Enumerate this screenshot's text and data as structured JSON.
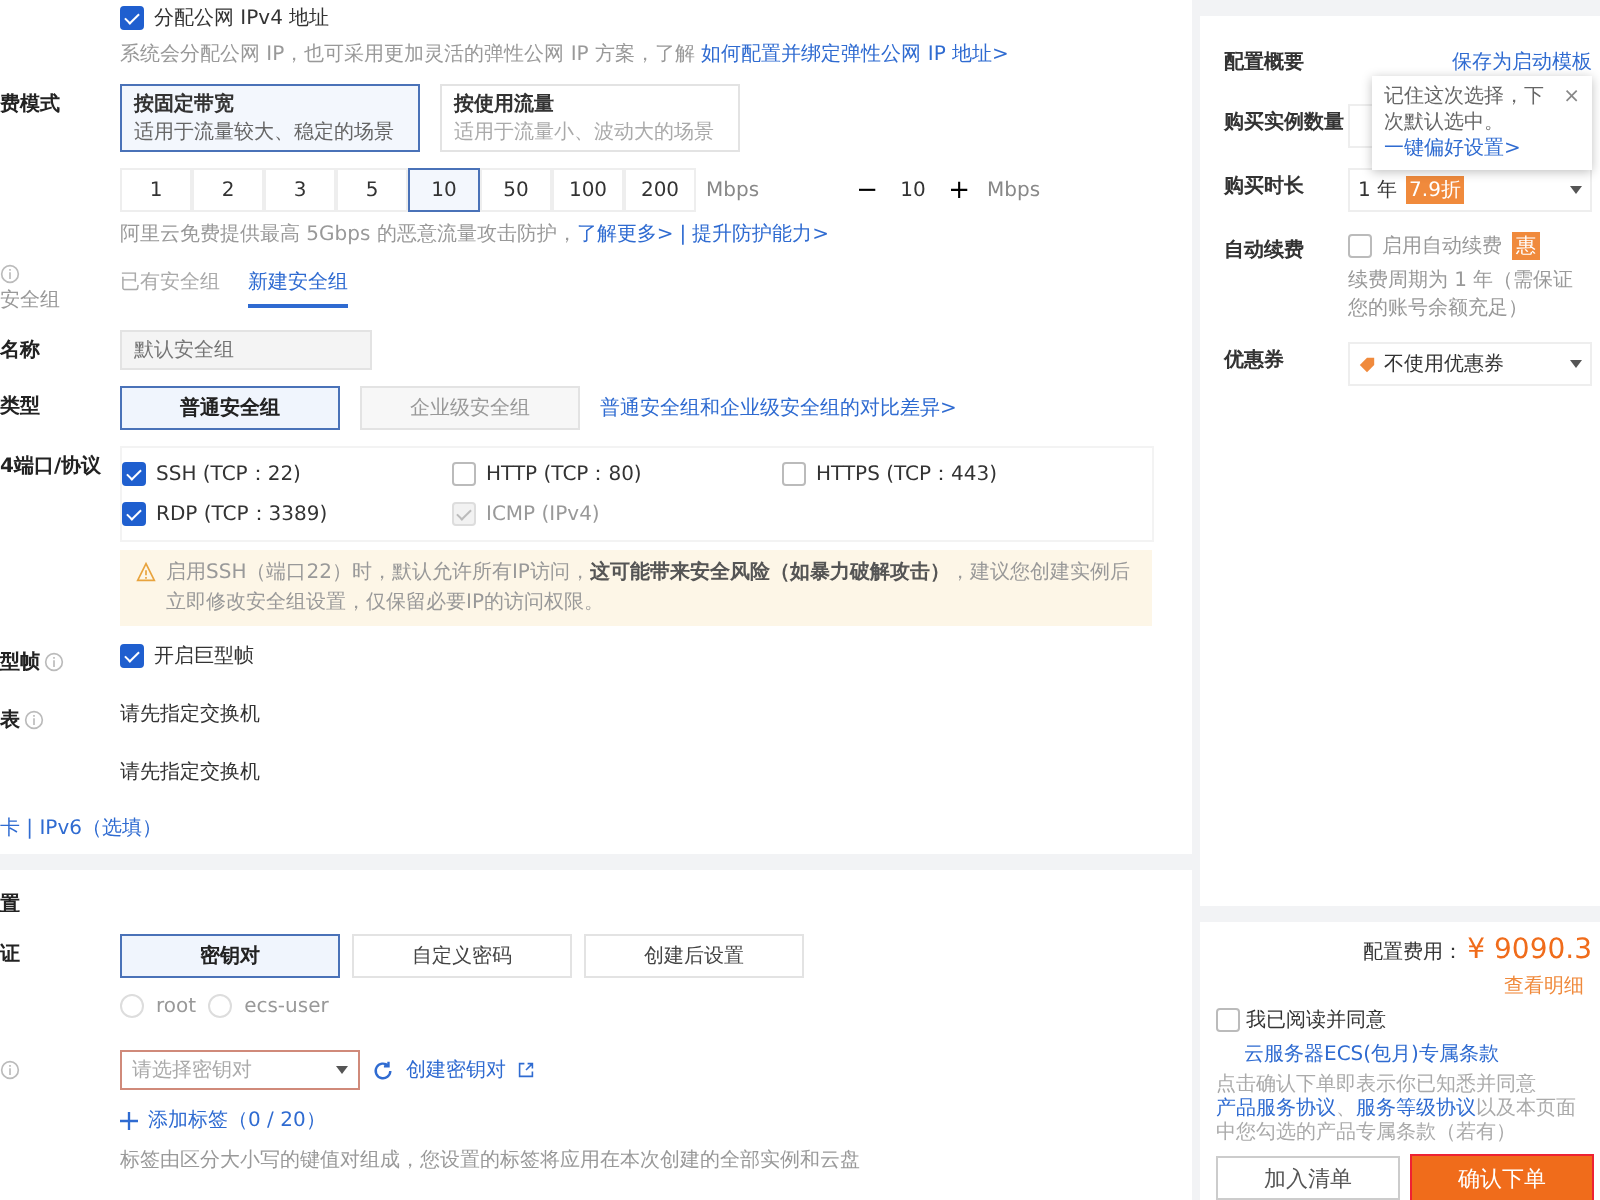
{
  "public_ip": {
    "checked": true,
    "label": "分配公网 IPv4 地址",
    "hint": "系统会分配公网 IP，也可采用更加灵活的弹性公网 IP 方案，了解 ",
    "hint_link": "如何配置并绑定弹性公网 IP 地址>"
  },
  "billing": {
    "label": "费模式",
    "options": [
      {
        "title": "按固定带宽",
        "desc": "适用于流量较大、稳定的场景",
        "selected": true
      },
      {
        "title": "按使用流量",
        "desc": "适用于流量小、波动大的场景",
        "selected": false
      }
    ]
  },
  "bandwidth": {
    "options": [
      {
        "label": "1",
        "selected": false
      },
      {
        "label": "2",
        "selected": false
      },
      {
        "label": "3",
        "selected": false
      },
      {
        "label": "5",
        "selected": false
      },
      {
        "label": "10",
        "selected": true
      },
      {
        "label": "50",
        "selected": false
      },
      {
        "label": "100",
        "selected": false
      },
      {
        "label": "200",
        "selected": false
      }
    ],
    "unit": "Mbps",
    "stepper": {
      "minus": "−",
      "value": "10",
      "plus": "+",
      "unit": "Mbps"
    },
    "hint": "阿里云免费提供最高 5Gbps 的恶意流量攻击防护，",
    "links": [
      "了解更多>",
      "提升防护能力>"
    ],
    "separator": "|"
  },
  "security_group": {
    "tabs": [
      {
        "label": "已有安全组",
        "selected": false
      },
      {
        "label": "新建安全组",
        "selected": true
      }
    ],
    "sub_label": "安全组",
    "name": {
      "label": "名称",
      "placeholder": "默认安全组"
    },
    "type": {
      "label": "类型",
      "options": [
        {
          "label": "普通安全组",
          "selected": true,
          "disabled": false
        },
        {
          "label": "企业级安全组",
          "selected": false,
          "disabled": true
        }
      ],
      "link": "普通安全组和企业级安全组的对比差异>"
    },
    "ports": {
      "label": "4端口/协议",
      "items": [
        {
          "label": "SSH (TCP：22)",
          "checked": true,
          "disabled": false
        },
        {
          "label": "HTTP (TCP：80)",
          "checked": false,
          "disabled": false
        },
        {
          "label": "HTTPS (TCP：443)",
          "checked": false,
          "disabled": false
        },
        {
          "label": "RDP (TCP：3389)",
          "checked": true,
          "disabled": false
        },
        {
          "label": "ICMP (IPv4)",
          "checked": true,
          "disabled": true
        }
      ]
    },
    "warning": "启用SSH（端口22）时，默认允许所有IP访问，**这可能带来安全风险（如暴力破解攻击）**，建议您创建实例后立即修改安全组设置，仅保留必要IP的访问权限。"
  },
  "jumbo": {
    "label": "型帧",
    "text": "开启巨型帧",
    "checked": true
  },
  "switch_rows": [
    {
      "label": "表",
      "text": "请先指定交换机"
    },
    {
      "text": "请先指定交换机"
    }
  ],
  "more_link": "卡 | IPv6（选填）",
  "admin": {
    "title": "置",
    "auth_label": "证",
    "auth_options": [
      {
        "label": "密钥对",
        "selected": true
      },
      {
        "label": "自定义密码",
        "selected": false
      },
      {
        "label": "创建后设置",
        "selected": false
      }
    ],
    "users": [
      {
        "label": "root",
        "selected": false
      },
      {
        "label": "ecs-user",
        "selected": false
      }
    ],
    "key_select": {
      "placeholder": "请选择密钥对",
      "error": true
    },
    "create_link": "创建密钥对",
    "add_tag": "添加标签（0 / 20）",
    "tag_hint": "标签由区分大小写的键值对组成，您设置的标签将应用在本次创建的全部实例和云盘"
  },
  "summary": {
    "title": "配置概要",
    "template_link": "保存为启动模板",
    "count_label": "购买实例数量",
    "tooltip": {
      "text": "记住这次选择，下次默认选中。",
      "link": "一键偏好设置>",
      "close": "×"
    },
    "duration": {
      "label": "购买时长",
      "value": "1 年",
      "badge": "7.9折"
    },
    "renew": {
      "label": "自动续费",
      "text": "启用自动续费",
      "checked": false,
      "badge": "惠",
      "hint": "续费周期为 1 年（需保证您的账号余额充足）"
    },
    "coupon": {
      "label": "优惠券",
      "value": "不使用优惠券"
    },
    "fee_label": "配置费用：",
    "fee": "¥ 9090.3",
    "detail_link": "查看明细",
    "agree": {
      "checked": false,
      "text": "我已阅读并同意 ",
      "link": "云服务器ECS(包月)专属条款"
    },
    "notice": {
      "before": "点击确认下单即表示你已知悉并同意",
      "links": [
        "产品服务协议",
        "服务等级协议"
      ],
      "sep": "、",
      "after": "以及本页面中您勾选的产品专属条款（若有）"
    },
    "buttons": [
      {
        "label": "加入清单",
        "kind": "secondary",
        "highlighted": false
      },
      {
        "label": "确认下单",
        "kind": "primary",
        "highlighted": true
      }
    ]
  }
}
